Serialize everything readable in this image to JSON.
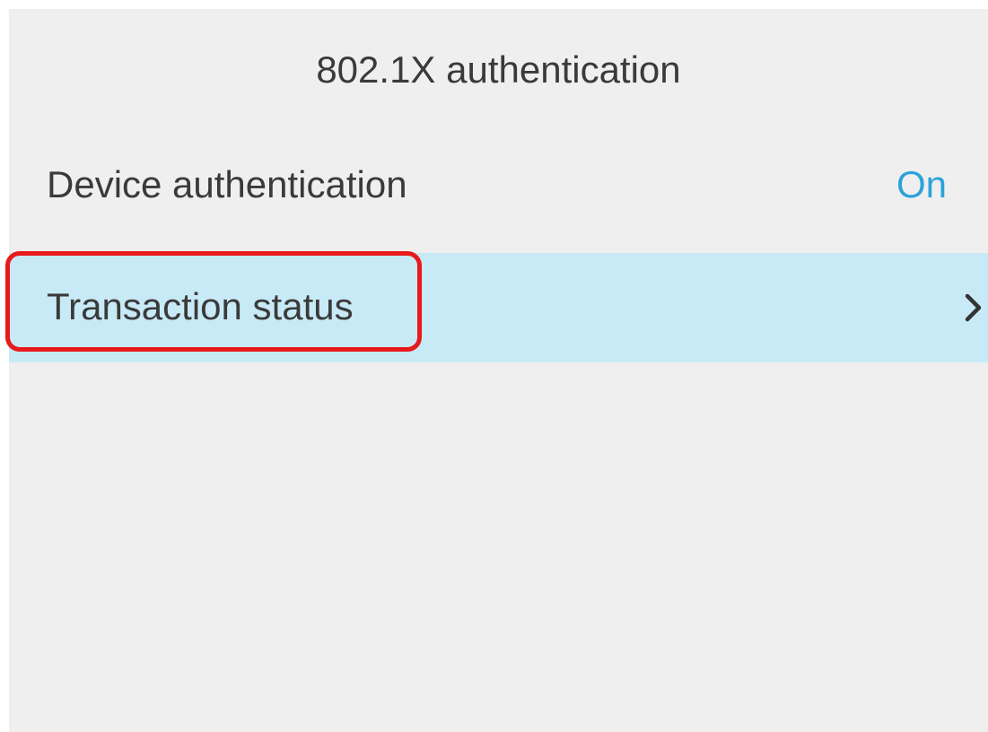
{
  "header": {
    "title": "802.1X authentication"
  },
  "settings": {
    "items": [
      {
        "label": "Device authentication",
        "value": "On"
      },
      {
        "label": "Transaction status",
        "icon": "chevron-right-icon"
      }
    ]
  },
  "annotation": {
    "highlight_color": "#e8191c"
  },
  "colors": {
    "screen_background": "#efefef",
    "selected_row": "#c8eaf6",
    "value_text": "#2aa3d8",
    "primary_text": "#3a3a3a"
  }
}
